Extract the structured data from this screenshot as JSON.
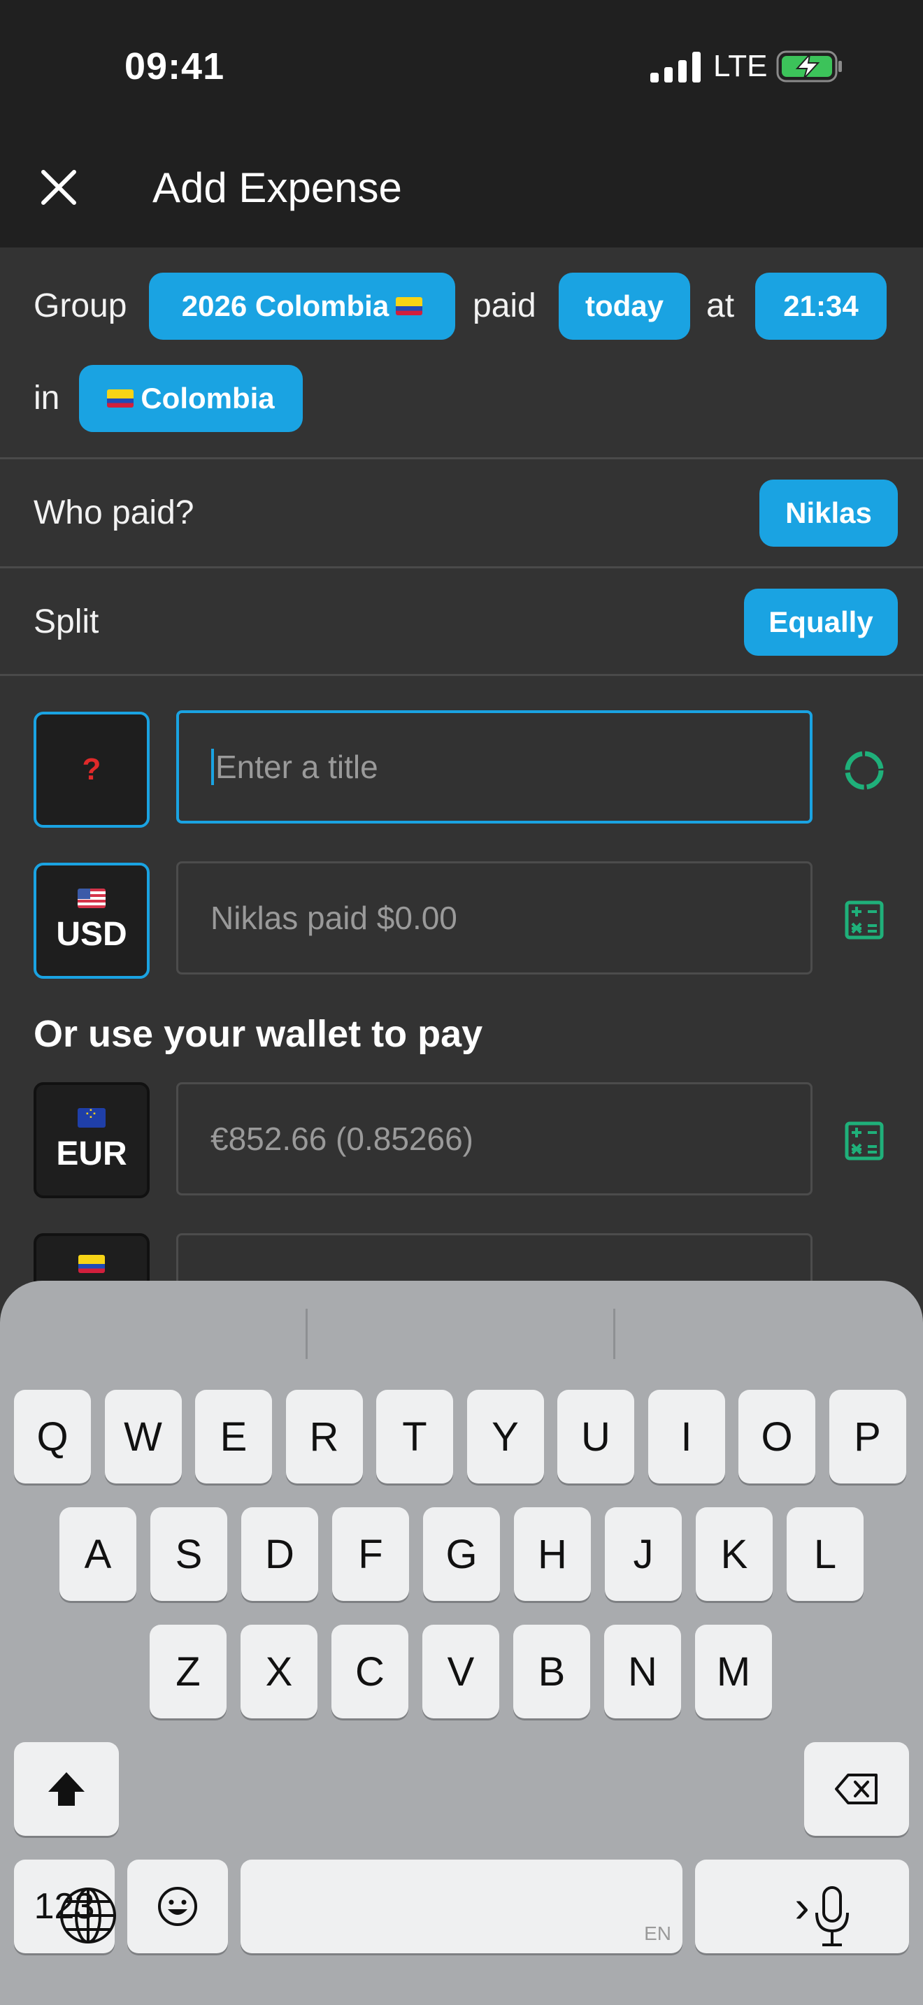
{
  "status_bar": {
    "time": "09:41",
    "network": "LTE"
  },
  "header": {
    "title": "Add Expense"
  },
  "meta_row": {
    "group_label": "Group",
    "group_value": "2026 Colombia",
    "paid_label": "paid",
    "date_value": "today",
    "at_label": "at",
    "time_value": "21:34",
    "in_label": "in",
    "country_value": "Colombia"
  },
  "who_paid": {
    "label": "Who paid?",
    "value": "Niklas"
  },
  "split": {
    "label": "Split",
    "value": "Equally"
  },
  "title_row": {
    "category_icon": "?",
    "placeholder": "Enter a title"
  },
  "amount_row": {
    "currency": "USD",
    "placeholder": "Niklas paid $0.00"
  },
  "wallet": {
    "heading": "Or use your wallet to pay",
    "rows": [
      {
        "currency": "EUR",
        "placeholder": "€852.66 (0.85266)"
      }
    ]
  },
  "keyboard": {
    "row1": [
      "Q",
      "W",
      "E",
      "R",
      "T",
      "Y",
      "U",
      "I",
      "O",
      "P"
    ],
    "row2": [
      "A",
      "S",
      "D",
      "F",
      "G",
      "H",
      "J",
      "K",
      "L"
    ],
    "row3": [
      "Z",
      "X",
      "C",
      "V",
      "B",
      "N",
      "M"
    ],
    "numbers_key": "123",
    "space_lang": "EN",
    "return_key": "›"
  },
  "colors": {
    "accent": "#1aa3e2",
    "green_icon": "#1fb07a",
    "background": "#333333"
  }
}
